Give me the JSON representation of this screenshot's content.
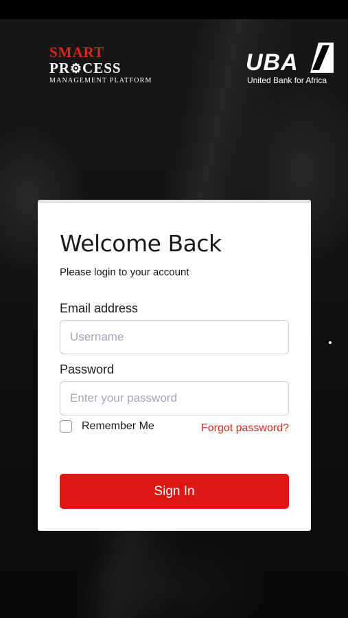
{
  "branding": {
    "spm_line1": "SMART",
    "spm_line2_left": "PR",
    "spm_line2_right": "CESS",
    "spm_sub": "MANAGEMENT PLATFORM",
    "uba_name": "UBA",
    "uba_tagline": "United Bank for Africa"
  },
  "login": {
    "title": "Welcome Back",
    "subtitle": "Please login to your account",
    "email_label": "Email address",
    "email_placeholder": "Username",
    "email_value": "",
    "password_label": "Password",
    "password_placeholder": "Enter your password",
    "password_value": "",
    "remember_label": "Remember Me",
    "remember_checked": false,
    "forgot_label": "Forgot password?",
    "signin_label": "Sign In"
  },
  "icons": {
    "gear": "gear-icon",
    "uba_mark": "uba-mark-icon",
    "checkbox": "checkbox-icon"
  },
  "colors": {
    "accent_red": "#dd1712",
    "link_red": "#e0231c",
    "brand_red": "#e0231c"
  }
}
